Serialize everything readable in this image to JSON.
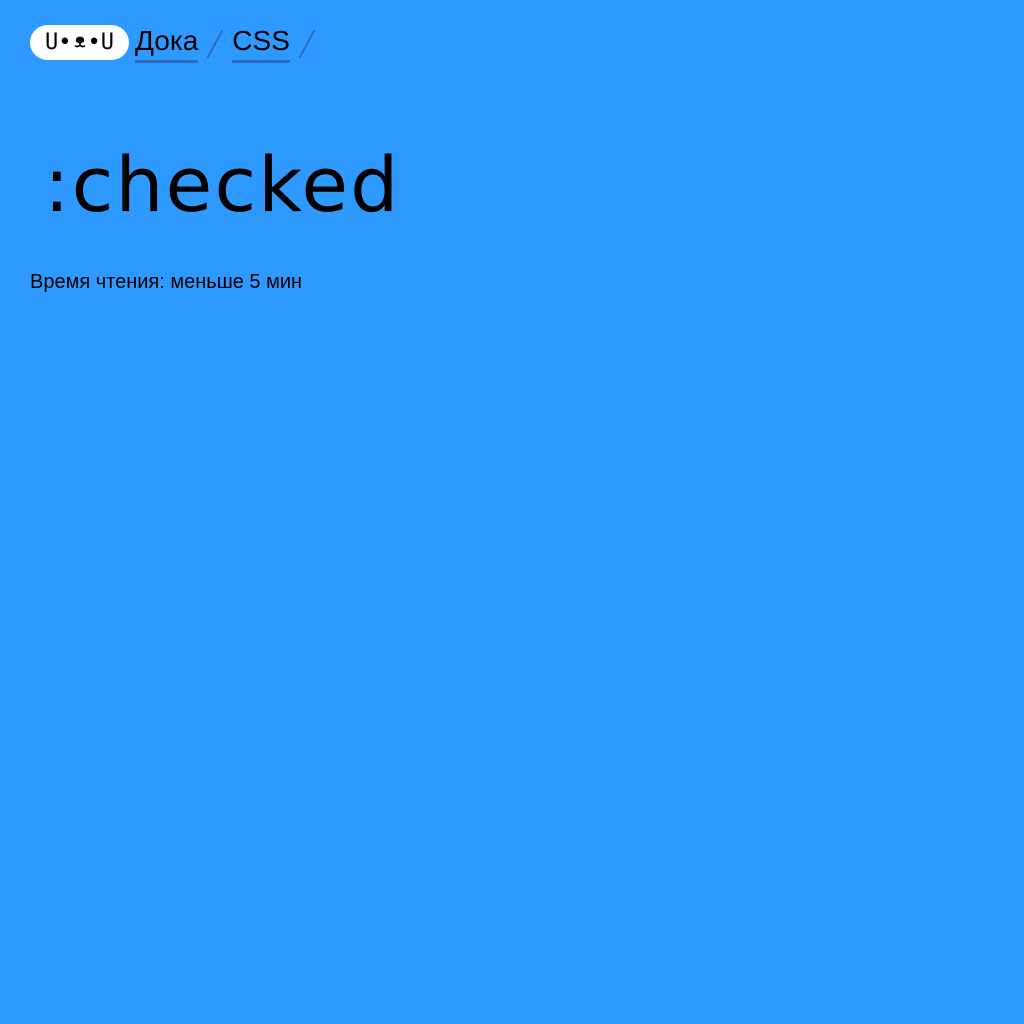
{
  "header": {
    "logo": {
      "left": "U•",
      "right": "•U",
      "icon": "dog-face-logo"
    },
    "breadcrumbs": [
      {
        "label": "Дока"
      },
      {
        "label": "CSS"
      }
    ],
    "separator_icon": "slash-separator-icon"
  },
  "article": {
    "title": ":checked",
    "reading_time": "Время чтения: меньше 5 мин"
  },
  "colors": {
    "background": "#2e9aff",
    "logo_background": "#ffffff",
    "link_underline": "#2b6cc0",
    "text": "#000000"
  }
}
